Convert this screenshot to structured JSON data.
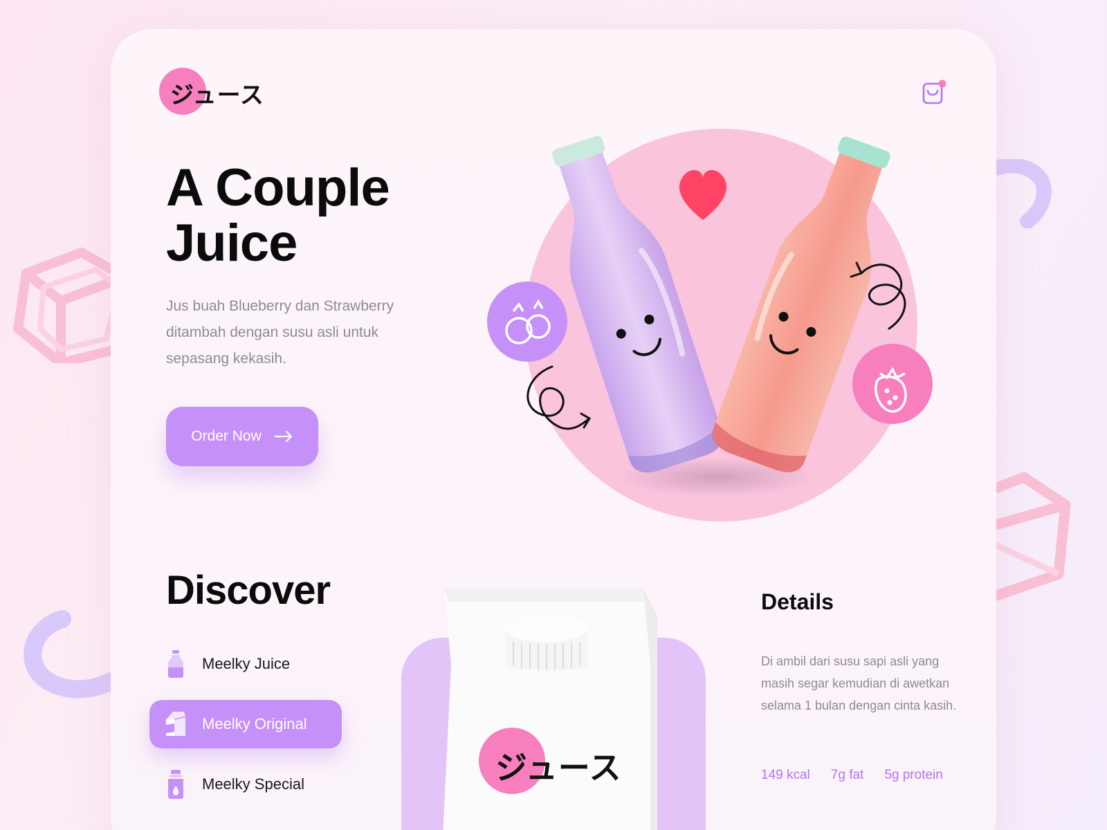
{
  "brand": {
    "logo_text": "ジュース"
  },
  "header": {
    "cart_icon": "shopping-bag-icon",
    "cart_badge_color": "#f77fbd"
  },
  "hero": {
    "title_line1": "A Couple",
    "title_line2": "Juice",
    "description": "Jus buah Blueberry dan Strawberry ditambah dengan susu asli untuk sepasang kekasih.",
    "cta_label": "Order Now",
    "cta_icon": "arrow-right-icon",
    "badges": [
      "blueberry-icon",
      "strawberry-icon"
    ]
  },
  "discover": {
    "title": "Discover",
    "items": [
      {
        "label": "Meelky Juice",
        "icon": "bottle-icon",
        "active": false
      },
      {
        "label": "Meelky Original",
        "icon": "milk-carton-icon",
        "active": true
      },
      {
        "label": "Meelky Special",
        "icon": "milk-drop-bottle-icon",
        "active": false
      }
    ]
  },
  "product": {
    "carton_logo": "ジュース"
  },
  "details": {
    "title": "Details",
    "description": "Di ambil dari susu sapi asli yang masih segar kemudian di awetkan selama 1 bulan dengan cinta kasih.",
    "stats": [
      "149 kcal",
      "7g fat",
      "5g protein"
    ]
  },
  "colors": {
    "accent_purple": "#c590f7",
    "accent_pink": "#f77fbd",
    "heart": "#ff4466",
    "stat_text": "#b176ee"
  }
}
